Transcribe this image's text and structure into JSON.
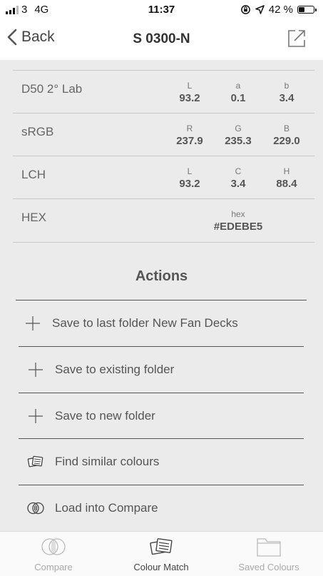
{
  "status_bar": {
    "carrier": "3",
    "network": "4G",
    "time": "11:37",
    "battery": "42 %",
    "battery_level": 0.42
  },
  "nav": {
    "back_label": "Back",
    "title": "S 0300-N"
  },
  "color_table": [
    {
      "label": "D50 2° Lab",
      "keys": [
        "L",
        "a",
        "b"
      ],
      "values": [
        "93.2",
        "0.1",
        "3.4"
      ]
    },
    {
      "label": "sRGB",
      "keys": [
        "R",
        "G",
        "B"
      ],
      "values": [
        "237.9",
        "235.3",
        "229.0"
      ]
    },
    {
      "label": "LCH",
      "keys": [
        "L",
        "C",
        "H"
      ],
      "values": [
        "93.2",
        "3.4",
        "88.4"
      ]
    }
  ],
  "hex_row": {
    "label": "HEX",
    "key": "hex",
    "value": "#EDEBE5"
  },
  "actions": {
    "title": "Actions",
    "items": [
      {
        "label": "Save to last folder New Fan Decks",
        "icon": "plus-icon"
      },
      {
        "label": "Save to existing folder",
        "icon": "plus-icon"
      },
      {
        "label": "Save to new folder",
        "icon": "plus-icon"
      },
      {
        "label": "Find similar colours",
        "icon": "colour-cards-icon"
      },
      {
        "label": "Load into Compare",
        "icon": "compare-circles-icon"
      }
    ]
  },
  "tabs": [
    {
      "label": "Compare",
      "icon": "compare-circles-icon",
      "active": false
    },
    {
      "label": "Colour Match",
      "icon": "colour-cards-icon",
      "active": true
    },
    {
      "label": "Saved Colours",
      "icon": "folder-icon",
      "active": false
    }
  ],
  "colors": {
    "background": "#ebebeb",
    "bar_background": "#ffffff",
    "text": "#555555",
    "inactive_tab": "#aaaaaa"
  }
}
